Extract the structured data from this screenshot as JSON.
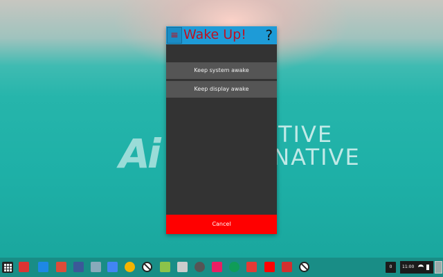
{
  "app": {
    "title": "Wake Up!",
    "menu_icon": "≡",
    "help_label": "?",
    "options": [
      {
        "label": "Keep system awake"
      },
      {
        "label": "Keep display awake"
      }
    ],
    "cancel_label": "Cancel"
  },
  "wallpaper": {
    "logo_text": "Ai",
    "line1": "TIVE",
    "line2": "RNATIVE"
  },
  "shelf": {
    "apps": [
      {
        "name": "launcher-icon"
      },
      {
        "name": "wake-up-app-icon",
        "color": "#d33"
      },
      {
        "name": "files-icon",
        "color": "#1e88e5"
      },
      {
        "name": "google-plus-icon",
        "color": "#dd4b39"
      },
      {
        "name": "facebook-icon",
        "color": "#3b5998"
      },
      {
        "name": "image-app-icon",
        "color": "#8ab"
      },
      {
        "name": "docs-icon",
        "color": "#4285f4"
      },
      {
        "name": "chrome-icon",
        "color": "#f4b400"
      },
      {
        "name": "blocked-app-icon",
        "color": "#fff"
      },
      {
        "name": "maps-icon",
        "color": "#8bc34a"
      },
      {
        "name": "star-app-icon",
        "color": "#ccc"
      },
      {
        "name": "gear-app-icon",
        "color": "#555"
      },
      {
        "name": "photos-icon",
        "color": "#e91e63"
      },
      {
        "name": "chrome-icon-2",
        "color": "#0f9d58"
      },
      {
        "name": "red-app-icon",
        "color": "#e53935"
      },
      {
        "name": "youtube-icon",
        "color": "#ff0000"
      },
      {
        "name": "record-app-icon",
        "color": "#d32f2f"
      },
      {
        "name": "blocked-app-icon-2",
        "color": "#fff"
      }
    ],
    "tray": {
      "counter": "0",
      "time": "11:00"
    }
  },
  "colors": {
    "header": "#1e9bd7",
    "title": "#c01020",
    "cancel": "#ff0000",
    "panel": "#333333",
    "option": "#555555"
  }
}
